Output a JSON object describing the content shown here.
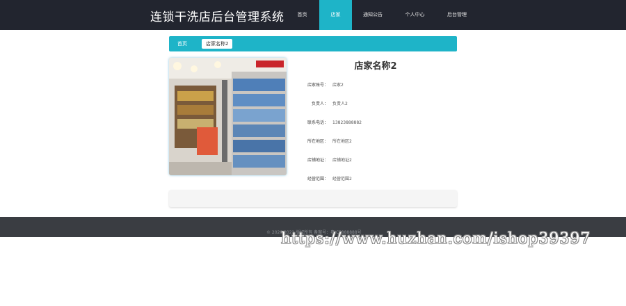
{
  "app": {
    "title": "连锁干洗店后台管理系统"
  },
  "nav": {
    "items": [
      "首页",
      "店家",
      "通知公告",
      "个人中心",
      "后台管理"
    ],
    "active_index": 1
  },
  "breadcrumb": {
    "home": "首页",
    "current": "店家名称2"
  },
  "store": {
    "name": "店家名称2",
    "fields": [
      {
        "label": "店家账号：",
        "value": "店家2"
      },
      {
        "label": "负责人：",
        "value": "负责人2"
      },
      {
        "label": "联系电话：",
        "value": "13823888882"
      },
      {
        "label": "所在地区：",
        "value": "所在地区2"
      },
      {
        "label": "店铺地址：",
        "value": "店铺地址2"
      },
      {
        "label": "经营范围：",
        "value": "经营范围2"
      }
    ]
  },
  "footer": {
    "text": "© 2020 2021 版权所有 备案号：粤ICP888888号"
  },
  "watermark": {
    "text": "https://www.huzhan.com/ishop39397"
  },
  "colors": {
    "accent": "#1eb4c8",
    "topbar": "#22252f",
    "footer": "#3a3d42"
  }
}
